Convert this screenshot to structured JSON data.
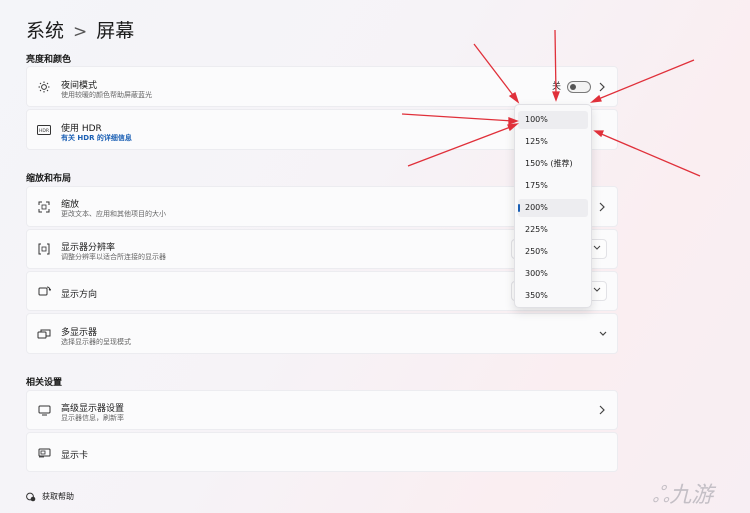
{
  "breadcrumb": {
    "parent": "系统",
    "separator": ">",
    "current": "屏幕"
  },
  "sections": {
    "brightness": "亮度和颜色",
    "scale_layout": "缩放和布局",
    "related": "相关设置"
  },
  "rows": {
    "night_light": {
      "title": "夜间模式",
      "subtitle": "使用较暖的颜色帮助屏蔽蓝光",
      "toggle_label": "关",
      "toggle_on": false
    },
    "hdr": {
      "title": "使用 HDR",
      "subtitle": "有关 HDR 的详细信息"
    },
    "scale": {
      "title": "缩放",
      "subtitle": "更改文本、应用和其他项目的大小"
    },
    "resolution": {
      "title": "显示器分辨率",
      "subtitle": "调整分辨率以适合所连接的显示器"
    },
    "orientation": {
      "title": "显示方向"
    },
    "multi": {
      "title": "多显示器",
      "subtitle": "选择显示器的呈现模式"
    },
    "advanced": {
      "title": "高级显示器设置",
      "subtitle": "显示器信息，刷新率"
    },
    "gpu": {
      "title": "显示卡"
    }
  },
  "scale_dropdown": {
    "options": [
      "100%",
      "125%",
      "150% (推荐)",
      "175%",
      "200%",
      "225%",
      "250%",
      "300%",
      "350%"
    ],
    "selected": "200%",
    "highlighted": "100%"
  },
  "help": {
    "label": "获取帮助"
  },
  "watermark": "九游",
  "colors": {
    "accent": "#1a5fb4",
    "annotation_arrow": "#e0303a"
  }
}
